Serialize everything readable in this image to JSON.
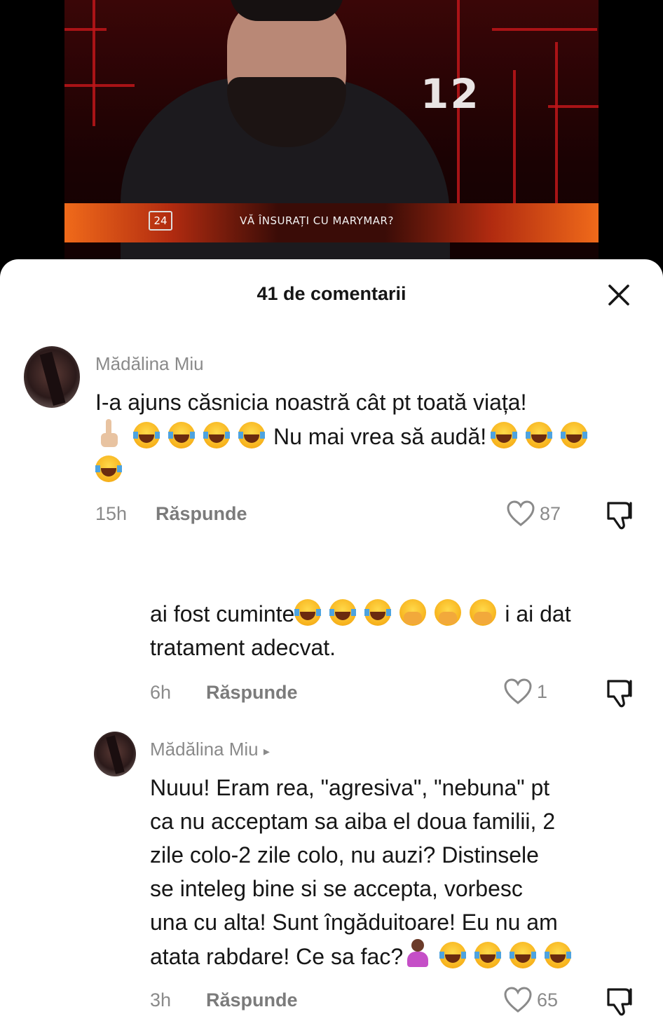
{
  "video": {
    "big_number": "12",
    "channel_badge": "24",
    "banner_text": "VĂ ÎNSURAȚI CU MARYMAR?"
  },
  "sheet": {
    "title": "41 de comentarii"
  },
  "comments": [
    {
      "name": "Mădălina Miu",
      "lines": [
        "I-a ajuns căsnicia noastră cât pt toată viața!",
        "Nu mai vrea să audă!"
      ],
      "time": "15h",
      "reply_label": "Răspunde",
      "likes": "87"
    },
    {
      "lines": [
        "ai fost cuminte",
        "i ai dat",
        "tratament adecvat."
      ],
      "time": "6h",
      "reply_label": "Răspunde",
      "likes": "1"
    },
    {
      "name": "Mădălina Miu",
      "name_arrow": "▸",
      "lines": [
        "Nuuu! Eram rea, \"agresiva\", \"nebuna\" pt",
        "ca nu acceptam sa aiba el doua familii, 2",
        "zile colo-2 zile colo, nu auzi? Distinsele",
        "se inteleg bine si se accepta, vorbesc",
        "una cu alta! Sunt îngăduitoare! Eu nu am",
        "atata rabdare! Ce sa fac?"
      ],
      "time": "3h",
      "reply_label": "Răspunde",
      "likes": "65"
    }
  ],
  "colors": {
    "sheet_bg": "#ffffff",
    "name_gray": "#8a8a8a",
    "text_dark": "#161616",
    "accent_red": "#c0161a",
    "banner_orange": "#f06a1a"
  },
  "icons": [
    "close-icon",
    "heart-icon",
    "dislike-icon",
    "laugh-emoji",
    "pointing-up-emoji",
    "hand-over-mouth-emoji",
    "shrug-emoji"
  ]
}
